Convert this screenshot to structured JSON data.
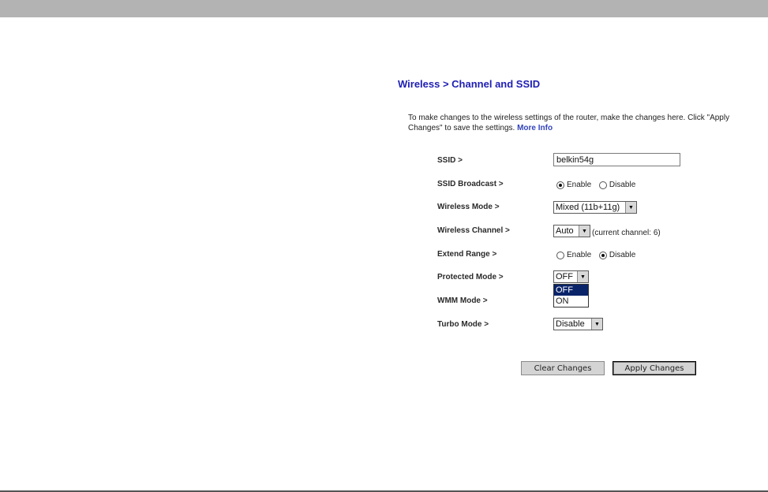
{
  "header": {
    "title": "Wireless > Channel and SSID"
  },
  "intro": {
    "text": "To make changes to the wireless settings of the router, make the changes here. Click \"Apply Changes\" to save the settings.",
    "more_info_label": "More Info"
  },
  "fields": {
    "ssid": {
      "label": "SSID >",
      "value": "belkin54g"
    },
    "ssid_broadcast": {
      "label": "SSID Broadcast >",
      "option_enable": "Enable",
      "option_disable": "Disable",
      "selected": "Enable"
    },
    "wireless_mode": {
      "label": "Wireless Mode >",
      "value": "Mixed (11b+11g)"
    },
    "wireless_channel": {
      "label": "Wireless Channel >",
      "value": "Auto",
      "note": "(current channel: 6)"
    },
    "extend_range": {
      "label": "Extend Range >",
      "option_enable": "Enable",
      "option_disable": "Disable",
      "selected": "Disable"
    },
    "protected_mode": {
      "label": "Protected Mode >",
      "value": "OFF",
      "options": [
        "OFF",
        "ON"
      ],
      "highlighted": "OFF",
      "dropdown_open": true
    },
    "wmm_mode": {
      "label": "WMM Mode >"
    },
    "turbo_mode": {
      "label": "Turbo Mode >",
      "value": "Disable"
    }
  },
  "buttons": {
    "clear_label": "Clear Changes",
    "apply_label": "Apply Changes"
  },
  "colors": {
    "title": "#1e1eb4",
    "link": "#3344bb",
    "header_bar": "#b3b3b3",
    "dropdown_highlight": "#0a246a"
  },
  "icons": {
    "select_arrow": "dropdown-arrow-icon",
    "radio": "radio-button-icon"
  }
}
